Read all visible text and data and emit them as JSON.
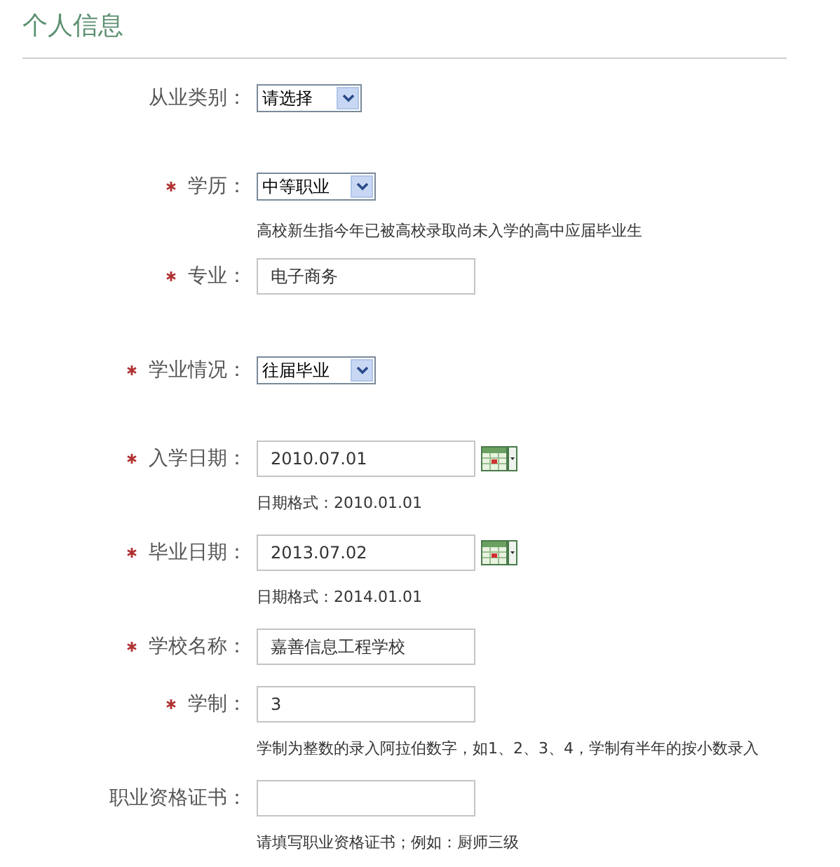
{
  "title": "个人信息",
  "fields": [
    {
      "label": "从业类别：",
      "required": false,
      "kind": "select",
      "value": "请选择"
    },
    {
      "label": "学历：",
      "required": true,
      "kind": "select",
      "value": "中等职业",
      "hint": "高校新生指今年已被高校录取尚未入学的高中应届毕业生"
    },
    {
      "label": "专业：",
      "required": true,
      "kind": "text",
      "value": "电子商务"
    },
    {
      "label": "学业情况：",
      "required": true,
      "kind": "select",
      "value": "往届毕业"
    },
    {
      "label": "入学日期：",
      "required": true,
      "kind": "date",
      "value": "2010.07.01",
      "hint": "日期格式：2010.01.01"
    },
    {
      "label": "毕业日期：",
      "required": true,
      "kind": "date",
      "value": "2013.07.02",
      "hint": "日期格式：2014.01.01"
    },
    {
      "label": "学校名称：",
      "required": true,
      "kind": "text",
      "value": "嘉善信息工程学校"
    },
    {
      "label": "学制：",
      "required": true,
      "kind": "text",
      "value": "3",
      "hint": "学制为整数的录入阿拉伯数字，如1、2、3、4，学制有半年的按小数录入"
    },
    {
      "label": "职业资格证书：",
      "required": false,
      "kind": "text",
      "hint": "请填写职业资格证书；例如：厨师三级"
    }
  ]
}
